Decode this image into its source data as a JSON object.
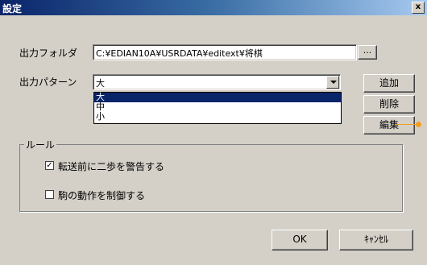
{
  "window": {
    "title": "設定",
    "close_label": "x"
  },
  "output_folder": {
    "label": "出力フォルダ",
    "value": "C:¥EDIAN10A¥USRDATA¥editext¥将棋",
    "browse_label": "..."
  },
  "output_pattern": {
    "label": "出力パターン",
    "selected": "大",
    "options": [
      "大",
      "中",
      "小"
    ]
  },
  "buttons": {
    "add": "追加",
    "delete": "削除",
    "edit": "編集",
    "ok": "OK",
    "cancel": "ｷｬﾝｾﾙ"
  },
  "rules": {
    "group_label": "ルール",
    "warn_two_steps": {
      "label": "転送前に二歩を警告する",
      "checked": true,
      "mark": "✓"
    },
    "control_piece": {
      "label": "駒の動作を制御する",
      "checked": false,
      "mark": ""
    }
  },
  "colors": {
    "titlebar_start": "#0a246a",
    "selection": "#0a246a",
    "annotation": "#f0a020"
  }
}
